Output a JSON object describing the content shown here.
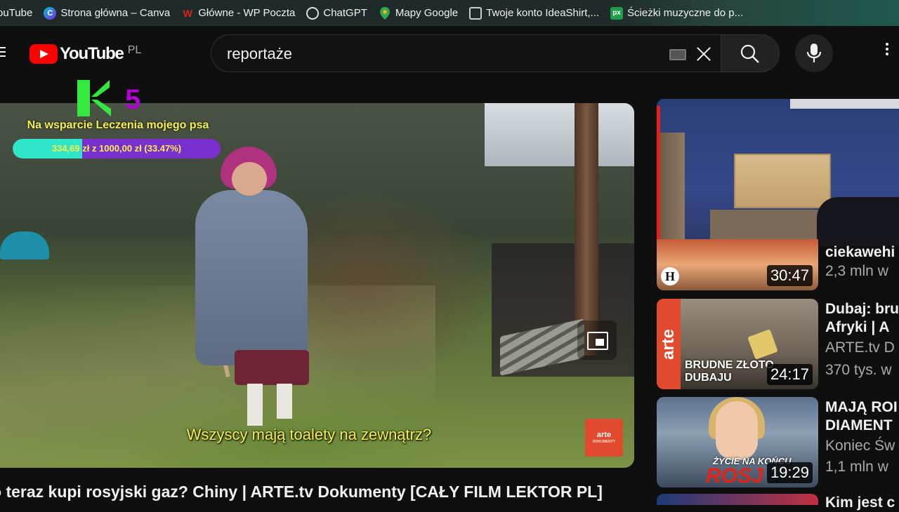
{
  "bookmarks": [
    {
      "label": "ouTube",
      "icon": "youtube-icon"
    },
    {
      "label": "Strona główna – Canva",
      "icon": "canva-icon"
    },
    {
      "label": "Główne - WP Poczta",
      "icon": "wp-icon"
    },
    {
      "label": "ChatGPT",
      "icon": "chatgpt-icon"
    },
    {
      "label": "Mapy Google",
      "icon": "maps-pin-icon"
    },
    {
      "label": "Twoje konto IdeaShirt,...",
      "icon": "shirt-icon"
    },
    {
      "label": "Ścieżki muzyczne do p...",
      "icon": "px-icon"
    }
  ],
  "header": {
    "logo_text": "YouTube",
    "country_code": "PL",
    "search_value": "reportaże"
  },
  "donation": {
    "count": "5",
    "title": "Na wsparcie Leczenia mojego psa",
    "progress_text": "334,69 zł z 1000,00 zł (33.47%)",
    "progress_fraction": 0.3347
  },
  "player": {
    "subtitle": "Wszyscy mają toalety na zewnątrz?",
    "badge": "arte",
    "badge_sub": "DOKUMENTY"
  },
  "video_title": "o teraz kupi rosyjski gaz? Chiny | ARTE.tv Dokumenty [CAŁY FILM LEKTOR PL]",
  "recommendations": [
    {
      "title": "ciekawehi",
      "channel": "2,3 mln w",
      "duration": "30:47",
      "thumb_logo": "H"
    },
    {
      "title_1": "Dubaj: bru",
      "title_2": "Afryki | A",
      "channel": "ARTE.tv D",
      "views": "370 tys. w",
      "duration": "24:17",
      "thumb_text_1": "BRUDNE ZŁOTO",
      "thumb_text_2": "DUBAJU",
      "thumb_side": "arte"
    },
    {
      "title_1": "MAJĄ ROI",
      "title_2": "DIAMENT",
      "channel": "Koniec Św",
      "views": "1,1 mln w",
      "duration": "19:29",
      "thumb_text_1": "ŻYCIE NA KOŃCU",
      "thumb_text_2": "ROSJ"
    },
    {
      "title": "Kim jest c"
    }
  ]
}
